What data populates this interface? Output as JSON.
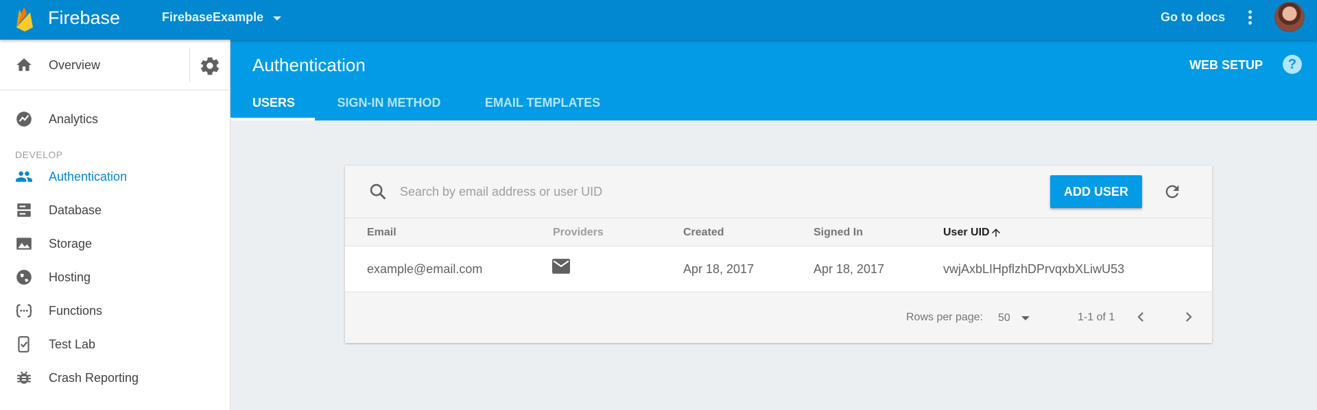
{
  "topbar": {
    "brand": "Firebase",
    "project": "FirebaseExample",
    "go_to_docs": "Go to docs",
    "brand_color": "#0288d1"
  },
  "sidebar": {
    "overview_label": "Overview",
    "analytics_label": "Analytics",
    "section_develop": "DEVELOP",
    "items": [
      {
        "label": "Authentication",
        "icon": "people-icon",
        "active": true
      },
      {
        "label": "Database",
        "icon": "database-icon",
        "active": false
      },
      {
        "label": "Storage",
        "icon": "image-icon",
        "active": false
      },
      {
        "label": "Hosting",
        "icon": "globe-icon",
        "active": false
      },
      {
        "label": "Functions",
        "icon": "functions-icon",
        "active": false
      },
      {
        "label": "Test Lab",
        "icon": "test-lab-icon",
        "active": false
      },
      {
        "label": "Crash Reporting",
        "icon": "bug-icon",
        "active": false
      }
    ]
  },
  "header": {
    "title": "Authentication",
    "web_setup": "WEB SETUP",
    "help": "?",
    "accent_color": "#039be5",
    "tabs": [
      {
        "label": "USERS",
        "active": true
      },
      {
        "label": "SIGN-IN METHOD",
        "active": false
      },
      {
        "label": "EMAIL TEMPLATES",
        "active": false
      }
    ]
  },
  "users": {
    "search_placeholder": "Search by email address or user UID",
    "add_user_label": "ADD USER",
    "columns": [
      "Email",
      "Providers",
      "Created",
      "Signed In",
      "User UID"
    ],
    "sorted_column": "User UID",
    "rows": [
      {
        "email": "example@email.com",
        "provider_icon": "mail-icon",
        "created": "Apr 18, 2017",
        "signed_in": "Apr 18, 2017",
        "uid": "vwjAxbLIHpflzhDPrvqxbXLiwU53"
      }
    ],
    "rows_per_page_label": "Rows per page:",
    "rows_per_page_value": "50",
    "range_label": "1-1 of 1"
  }
}
